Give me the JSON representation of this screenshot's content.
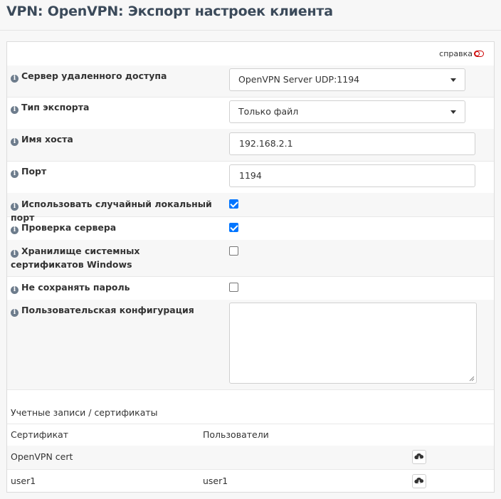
{
  "page": {
    "title": "VPN: OpenVPN: Экспорт настроек клиента"
  },
  "help": {
    "label": "справка"
  },
  "form": {
    "remote_server": {
      "label": "Сервер удаленного доступа",
      "value": "OpenVPN Server UDP:1194"
    },
    "export_type": {
      "label": "Тип экспорта",
      "value": "Только файл"
    },
    "hostname": {
      "label": "Имя хоста",
      "value": "192.168.2.1"
    },
    "port": {
      "label": "Порт",
      "value": "1194"
    },
    "random_local_port": {
      "label": "Использовать случайный локальный порт",
      "checked": true
    },
    "verify_server": {
      "label": "Проверка сервера",
      "checked": true
    },
    "windows_cert_store": {
      "label": "Хранилище системных сертификатов Windows",
      "checked": false
    },
    "dont_save_password": {
      "label": "Не сохранять пароль",
      "checked": false
    },
    "custom_config": {
      "label": "Пользовательская конфигурация",
      "value": ""
    }
  },
  "accounts": {
    "title": "Учетные записи / сертификаты",
    "columns": [
      "Сертификат",
      "Пользователи"
    ],
    "rows": [
      {
        "certificate": "OpenVPN cert",
        "users": ""
      },
      {
        "certificate": "user1",
        "users": "user1"
      }
    ]
  },
  "icons": {
    "info": "info-icon",
    "download": "cloud-download-icon",
    "help_toggle": "toggle-icon"
  }
}
